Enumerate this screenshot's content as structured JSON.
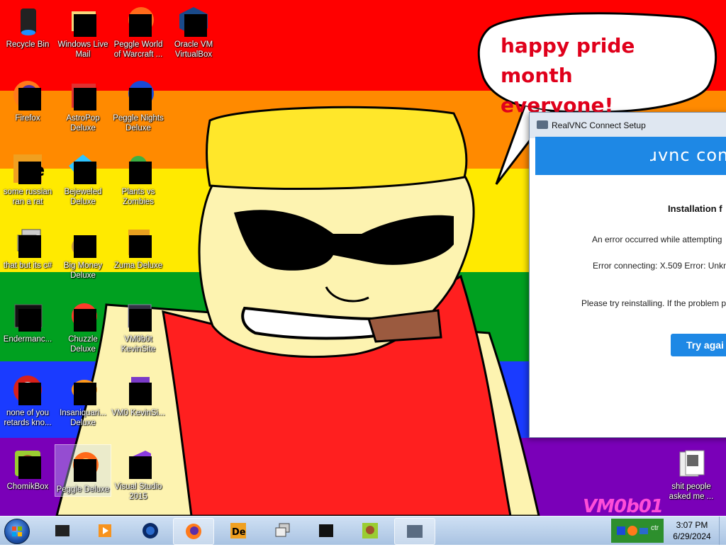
{
  "wallpaper": {
    "stripes": [
      "#ff0000",
      "#ff8a00",
      "#ffea00",
      "#00a020",
      "#1a3bff",
      "#7a00b8"
    ],
    "speech_line1": "happy pride month",
    "speech_line2": "everyone!",
    "watermark": "VM0b01"
  },
  "desktop_icons": [
    {
      "label": "Recycle Bin"
    },
    {
      "label": "Windows Live Mail"
    },
    {
      "label": "Peggle World of Warcraft ..."
    },
    {
      "label": "Oracle VM VirtualBox"
    },
    {
      "label": "Firefox"
    },
    {
      "label": "AstroPop Deluxe"
    },
    {
      "label": "Peggle Nights Deluxe"
    },
    {
      "label": "some russian ran a rat"
    },
    {
      "label": "Bejeweled Deluxe"
    },
    {
      "label": "Plants vs Zombies"
    },
    {
      "label": "that but its c#"
    },
    {
      "label": "Big Money Deluxe"
    },
    {
      "label": "Zuma Deluxe"
    },
    {
      "label": "Endermanc..."
    },
    {
      "label": "Chuzzle Deluxe"
    },
    {
      "label": "VM0b0t KevinSite"
    },
    {
      "label": "none of you retards kno..."
    },
    {
      "label": "Insaniquari... Deluxe"
    },
    {
      "label": "VM0 KevinSi..."
    },
    {
      "label": "ChomikBox"
    },
    {
      "label": "Peggle Deluxe"
    },
    {
      "label": "Visual Studio 2015"
    },
    {
      "label": "shit people asked me ..."
    }
  ],
  "dialog": {
    "title": "RealVNC Connect Setup",
    "brand": "ɹvnc con",
    "heading": "Installation f",
    "line1": "An error occurred while attempting",
    "line2": "Error connecting: X.509 Error: Unkno",
    "line3": "Please try reinstalling. If the problem p",
    "button": "Try agai"
  },
  "taskbar": {
    "time": "3:07 PM",
    "date": "6/29/2024",
    "pinned": [
      "terminal-icon",
      "media-player-icon",
      "globe-icon",
      "firefox-icon",
      "de-icon",
      "windows-icon",
      "endermanch-icon",
      "chomikbox-icon",
      "realvnc-icon"
    ],
    "tray_partial_text": "ctr"
  }
}
